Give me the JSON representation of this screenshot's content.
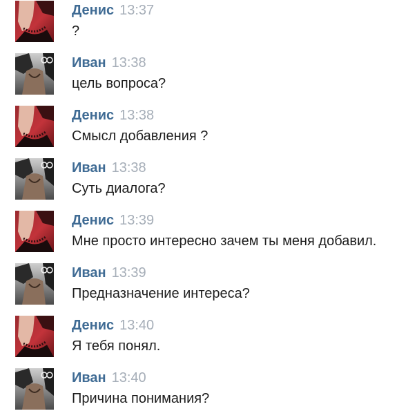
{
  "messages": [
    {
      "author": "Денис",
      "time": "13:37",
      "text": "?",
      "avatar": "denis-avatar"
    },
    {
      "author": "Иван",
      "time": "13:38",
      "text": "цель вопроса?",
      "avatar": "ivan-avatar"
    },
    {
      "author": "Денис",
      "time": "13:38",
      "text": "Смысл добавления ?",
      "avatar": "denis-avatar"
    },
    {
      "author": "Иван",
      "time": "13:38",
      "text": "Суть диалога?",
      "avatar": "ivan-avatar"
    },
    {
      "author": "Денис",
      "time": "13:39",
      "text": "Мне просто интересно зачем ты меня добавил.",
      "avatar": "denis-avatar"
    },
    {
      "author": "Иван",
      "time": "13:39",
      "text": "Предназначение интереса?",
      "avatar": "ivan-avatar"
    },
    {
      "author": "Денис",
      "time": "13:40",
      "text": "Я тебя понял.",
      "avatar": "denis-avatar"
    },
    {
      "author": "Иван",
      "time": "13:40",
      "text": "Причина понимания?",
      "avatar": "ivan-avatar"
    }
  ],
  "colors": {
    "author_name": "#3f6b94",
    "timestamp": "#a6aeb8",
    "message_text": "#1d1d1d",
    "background": "#ffffff"
  }
}
